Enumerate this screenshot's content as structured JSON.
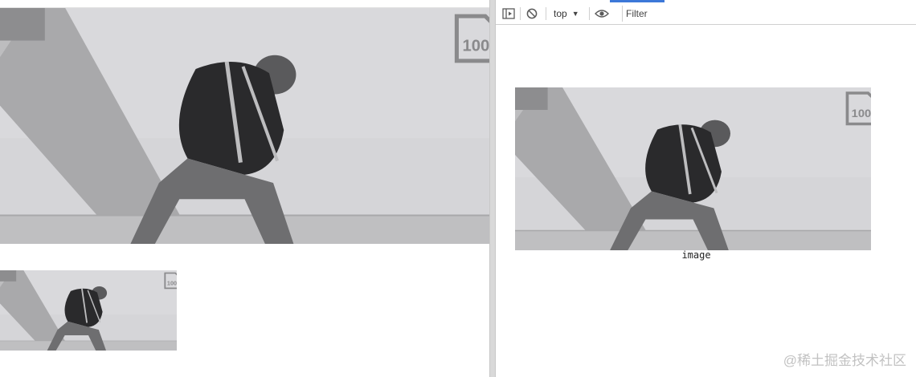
{
  "devtools": {
    "toolbar": {
      "context_label": "top",
      "filter_placeholder": "Filter",
      "icons": [
        "sidebar-toggle-icon",
        "clear-console-icon",
        "eye-icon"
      ]
    },
    "console": {
      "output_label": "image"
    }
  },
  "watermark": "@稀土掘金技术社区"
}
